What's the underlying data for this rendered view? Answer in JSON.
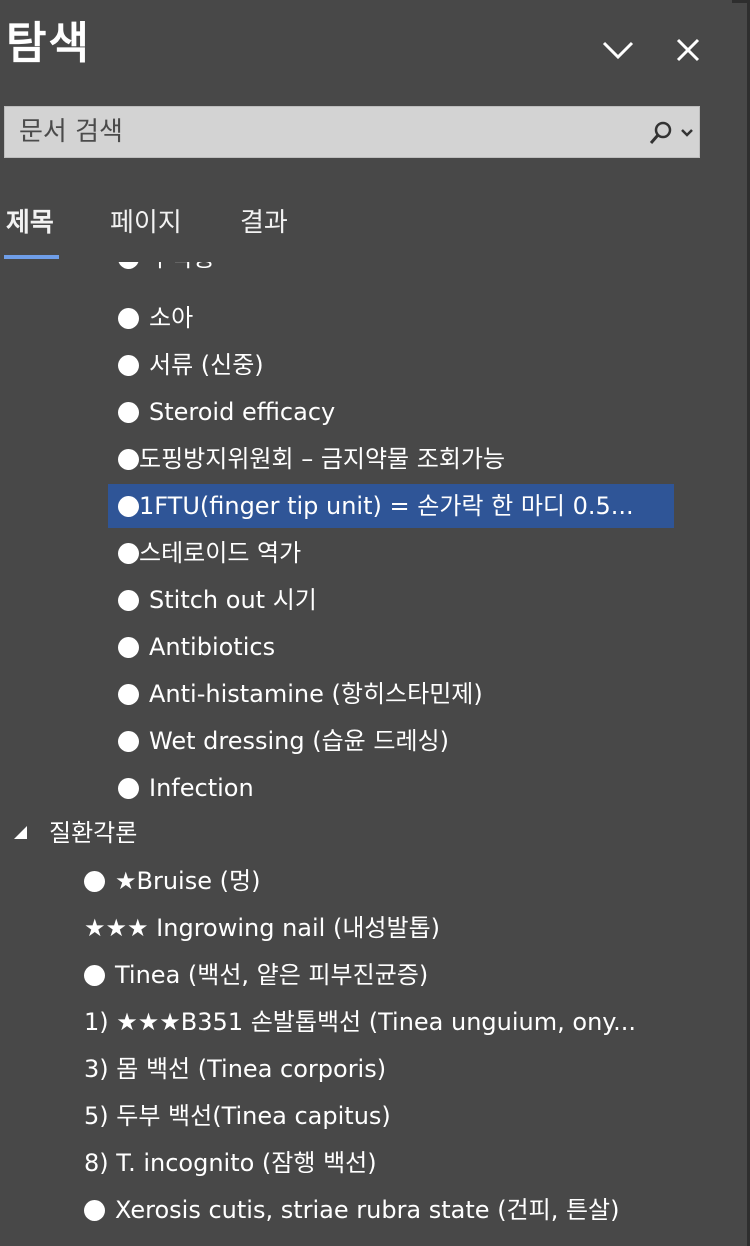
{
  "panel": {
    "title": "탐색",
    "chevron_icon": "chevron-down-icon",
    "close_icon": "close-icon"
  },
  "search": {
    "placeholder": "문서 검색",
    "icon": "search-icon"
  },
  "tabs": [
    {
      "label": "제목",
      "active": true
    },
    {
      "label": "페이지",
      "active": false
    },
    {
      "label": "결과",
      "active": false
    }
  ],
  "tree": {
    "clipped_top_label": "부작용",
    "items": [
      {
        "label": "소아"
      },
      {
        "label": "서류 (신중)"
      },
      {
        "label": "Steroid efficacy"
      },
      {
        "label": "도핑방지위원회 – 금지약물 조회가능"
      },
      {
        "label": "1FTU(finger tip unit) = 손가락 한 마디 0.5..."
      },
      {
        "label": "스테로이드 역가"
      },
      {
        "label": "Stitch out 시기"
      },
      {
        "label": "Antibiotics"
      },
      {
        "label": "Anti-histamine (항히스타민제)"
      },
      {
        "label": "Wet dressing (습윤 드레싱)"
      },
      {
        "label": "Infection"
      }
    ],
    "section_label": "질환각론",
    "section_items": [
      {
        "label": "★Bruise (멍)"
      },
      {
        "label": "★★★ Ingrowing nail (내성발톱)"
      },
      {
        "label": "Tinea (백선, 얕은 피부진균증)"
      },
      {
        "label": "1) ★★★B351 손발톱백선 (Tinea unguium, ony..."
      },
      {
        "label": "3) 몸 백선 (Tinea corporis)"
      },
      {
        "label": "5) 두부 백선(Tinea capitus)"
      },
      {
        "label": "8) T. incognito (잠행 백선)"
      },
      {
        "label": "Xerosis cutis,  striae rubra state  (건피, 튼살)"
      }
    ]
  },
  "colors": {
    "background": "#484848",
    "selection": "#2f5597",
    "tab_underline": "#6f9ee8",
    "search_bg": "#d3d3d3"
  }
}
